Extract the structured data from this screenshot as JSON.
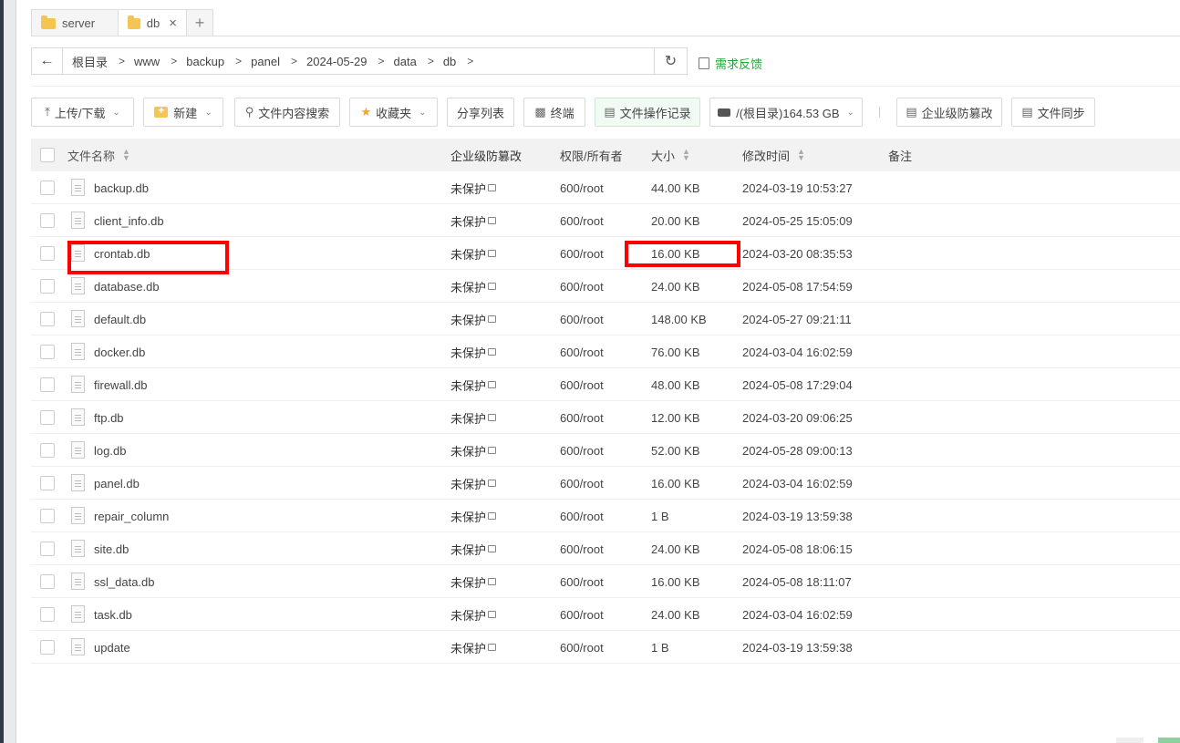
{
  "tabs": [
    {
      "label": "server",
      "active": false
    },
    {
      "label": "db",
      "active": true
    }
  ],
  "tab_add": "+",
  "tab_close": "×",
  "breadcrumb": [
    "根目录",
    "www",
    "backup",
    "panel",
    "2024-05-29",
    "data",
    "db"
  ],
  "feedback": "需求反馈",
  "toolbar": {
    "upload": "上传/下载",
    "new": "新建",
    "search": "文件内容搜索",
    "favorites": "收藏夹",
    "share": "分享列表",
    "terminal": "终端",
    "oplog": "文件操作记录",
    "disk": "/(根目录)164.53 GB",
    "tamper": "企业级防篡改",
    "sync": "文件同步"
  },
  "columns": {
    "name": "文件名称",
    "protect": "企业级防篡改",
    "perm": "权限/所有者",
    "size": "大小",
    "mtime": "修改时间",
    "note": "备注"
  },
  "files": [
    {
      "name": "backup.db",
      "protect": "未保护",
      "perm": "600/root",
      "size": "44.00 KB",
      "mtime": "2024-03-19 10:53:27"
    },
    {
      "name": "client_info.db",
      "protect": "未保护",
      "perm": "600/root",
      "size": "20.00 KB",
      "mtime": "2024-05-25 15:05:09"
    },
    {
      "name": "crontab.db",
      "protect": "未保护",
      "perm": "600/root",
      "size": "16.00 KB",
      "mtime": "2024-03-20 08:35:53"
    },
    {
      "name": "database.db",
      "protect": "未保护",
      "perm": "600/root",
      "size": "24.00 KB",
      "mtime": "2024-05-08 17:54:59"
    },
    {
      "name": "default.db",
      "protect": "未保护",
      "perm": "600/root",
      "size": "148.00 KB",
      "mtime": "2024-05-27 09:21:11"
    },
    {
      "name": "docker.db",
      "protect": "未保护",
      "perm": "600/root",
      "size": "76.00 KB",
      "mtime": "2024-03-04 16:02:59"
    },
    {
      "name": "firewall.db",
      "protect": "未保护",
      "perm": "600/root",
      "size": "48.00 KB",
      "mtime": "2024-05-08 17:29:04"
    },
    {
      "name": "ftp.db",
      "protect": "未保护",
      "perm": "600/root",
      "size": "12.00 KB",
      "mtime": "2024-03-20 09:06:25"
    },
    {
      "name": "log.db",
      "protect": "未保护",
      "perm": "600/root",
      "size": "52.00 KB",
      "mtime": "2024-05-28 09:00:13"
    },
    {
      "name": "panel.db",
      "protect": "未保护",
      "perm": "600/root",
      "size": "16.00 KB",
      "mtime": "2024-03-04 16:02:59"
    },
    {
      "name": "repair_column",
      "protect": "未保护",
      "perm": "600/root",
      "size": "1 B",
      "mtime": "2024-03-19 13:59:38"
    },
    {
      "name": "site.db",
      "protect": "未保护",
      "perm": "600/root",
      "size": "24.00 KB",
      "mtime": "2024-05-08 18:06:15"
    },
    {
      "name": "ssl_data.db",
      "protect": "未保护",
      "perm": "600/root",
      "size": "16.00 KB",
      "mtime": "2024-05-08 18:11:07"
    },
    {
      "name": "task.db",
      "protect": "未保护",
      "perm": "600/root",
      "size": "24.00 KB",
      "mtime": "2024-03-04 16:02:59"
    },
    {
      "name": "update",
      "protect": "未保护",
      "perm": "600/root",
      "size": "1 B",
      "mtime": "2024-03-19 13:59:38"
    }
  ],
  "colors": {
    "accent": "#20a53a",
    "highlight": "#ff0000"
  }
}
